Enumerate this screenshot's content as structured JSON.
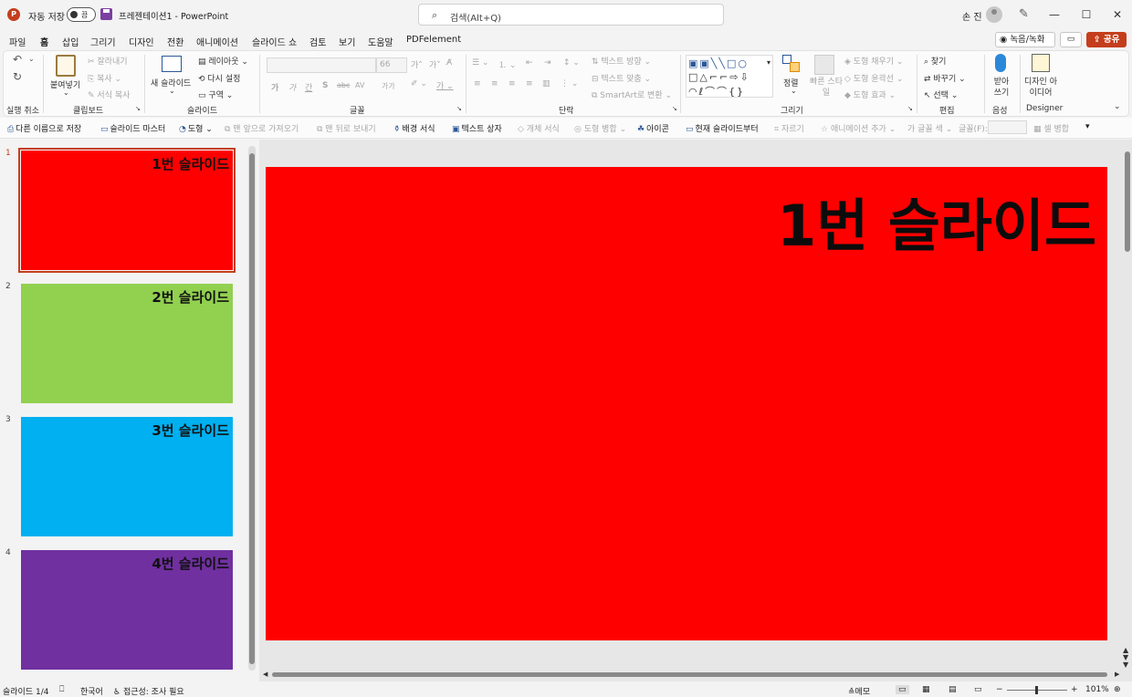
{
  "titlebar": {
    "logo_letter": "P",
    "autosave_label": "자동 저장",
    "autosave_state": "끔",
    "doc_title": "프레젠테이션1 - PowerPoint",
    "search_placeholder": "검색(Alt+Q)",
    "user_name": "손 진",
    "minimize": "—",
    "maximize": "☐",
    "close": "✕"
  },
  "menu": {
    "tabs": [
      "파일",
      "홈",
      "삽입",
      "그리기",
      "디자인",
      "전환",
      "애니메이션",
      "슬라이드 쇼",
      "검토",
      "보기",
      "도움말",
      "PDFelement"
    ],
    "record": "녹음/녹화",
    "share": "공유"
  },
  "ribbon": {
    "undo": "실행 취소",
    "clipboard": {
      "group": "클립보드",
      "paste": "붙여넣기",
      "cut": "잘라내기",
      "copy": "복사",
      "format_painter": "서식 복사"
    },
    "slides": {
      "group": "슬라이드",
      "new_slide": "새 슬라이드",
      "layout": "레이아웃",
      "reset": "다시 설정",
      "section": "구역"
    },
    "font": {
      "group": "글꼴",
      "size": "66",
      "bold": "가",
      "italic": "가",
      "underline": "간",
      "shadow": "S",
      "strike": "abc",
      "spacing": "AV",
      "case": "가가"
    },
    "paragraph": {
      "group": "단락",
      "text_direction": "텍스트 방향",
      "align_text": "텍스트 맞춤",
      "smartart": "SmartArt로 변환"
    },
    "drawing": {
      "group": "그리기",
      "arrange": "정렬",
      "quick_styles": "빠른 스타일",
      "fill": "도형 채우기",
      "outline": "도형 윤곽선",
      "effects": "도형 효과"
    },
    "editing": {
      "group": "편집",
      "find": "찾기",
      "replace": "바꾸기",
      "select": "선택"
    },
    "voice": {
      "group": "음성",
      "dictate": "받아 쓰기"
    },
    "designer": {
      "group": "Designer",
      "ideas": "디자인 아이디어"
    }
  },
  "quick_access": [
    {
      "label": "다른 이름으로 저장",
      "enabled": true
    },
    {
      "label": "슬라이드 마스터",
      "enabled": true
    },
    {
      "label": "도형",
      "enabled": true
    },
    {
      "label": "맨 앞으로 가져오기",
      "enabled": false
    },
    {
      "label": "맨 뒤로 보내기",
      "enabled": false
    },
    {
      "label": "배경 서식",
      "enabled": true
    },
    {
      "label": "텍스트 상자",
      "enabled": true
    },
    {
      "label": "개체 서식",
      "enabled": false
    },
    {
      "label": "도형 병합",
      "enabled": false
    },
    {
      "label": "아이콘",
      "enabled": true
    },
    {
      "label": "현재 슬라이드부터",
      "enabled": true
    },
    {
      "label": "자르기",
      "enabled": false
    },
    {
      "label": "애니메이션 추가",
      "enabled": false
    },
    {
      "label": "글꼴 색",
      "enabled": false
    },
    {
      "label": "글꼴(F):",
      "enabled": false
    },
    {
      "label": "셀 병합",
      "enabled": false
    }
  ],
  "slides": [
    {
      "number": "1",
      "title": "1번 슬라이드",
      "color": "#ff0000",
      "selected": true
    },
    {
      "number": "2",
      "title": "2번 슬라이드",
      "color": "#92d050",
      "selected": false
    },
    {
      "number": "3",
      "title": "3번 슬라이드",
      "color": "#00b0f0",
      "selected": false
    },
    {
      "number": "4",
      "title": "4번 슬라이드",
      "color": "#7030a0",
      "selected": false
    }
  ],
  "current_slide": {
    "title": "1번 슬라이드",
    "color": "#ff0000"
  },
  "status": {
    "slide_count": "슬라이드 1/4",
    "language": "한국어",
    "accessibility": "접근성: 조사 필요",
    "notes": "메모",
    "zoom": "101%"
  },
  "colors": {
    "accent": "#c43e1c"
  }
}
